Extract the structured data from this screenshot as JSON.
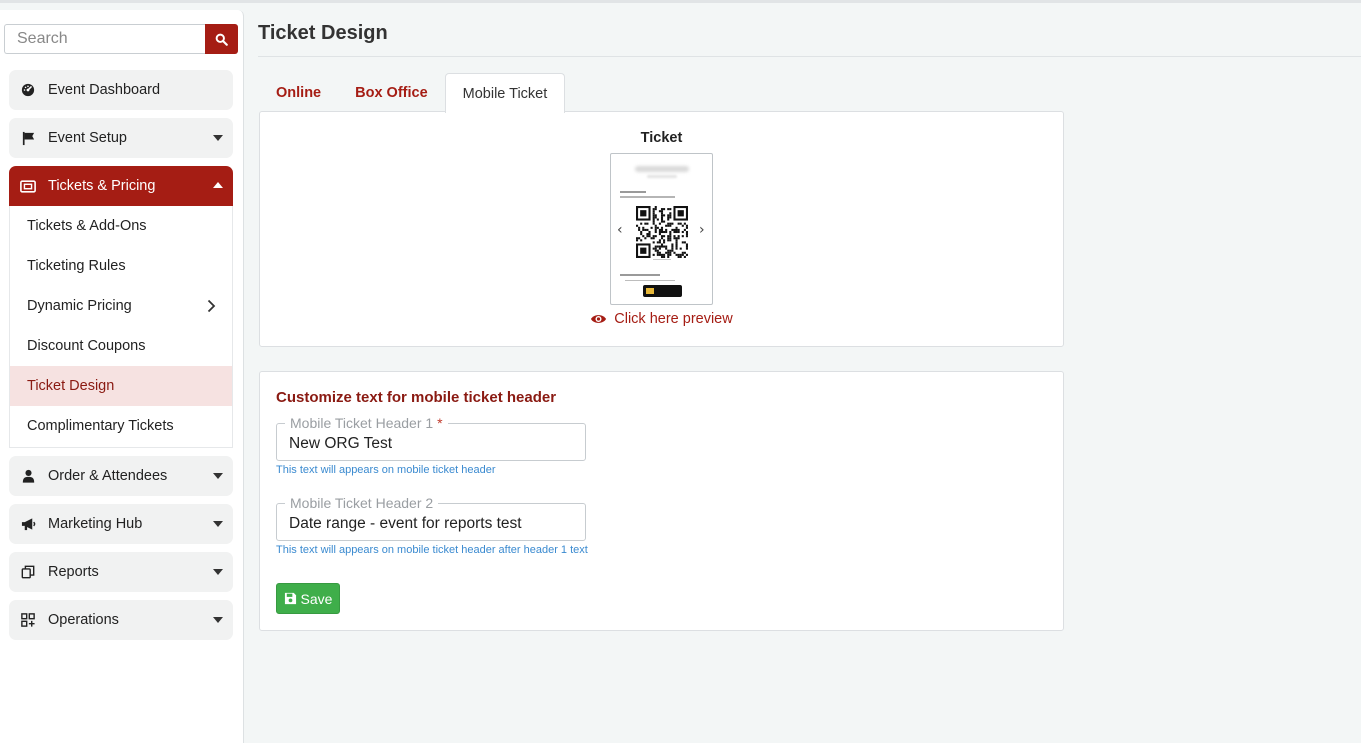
{
  "sidebar": {
    "search": {
      "placeholder": "Search",
      "value": ""
    },
    "items": [
      {
        "label": "Event Dashboard",
        "icon": "dashboard-icon"
      },
      {
        "label": "Event Setup",
        "icon": "flag-icon"
      },
      {
        "label": "Tickets & Pricing",
        "icon": "ticket-icon",
        "expanded": true
      },
      {
        "label": "Order & Attendees",
        "icon": "user-icon"
      },
      {
        "label": "Marketing Hub",
        "icon": "megaphone-icon"
      },
      {
        "label": "Reports",
        "icon": "copy-icon"
      },
      {
        "label": "Operations",
        "icon": "grid-plus-icon"
      }
    ],
    "submenu": [
      {
        "label": "Tickets & Add-Ons"
      },
      {
        "label": "Ticketing Rules"
      },
      {
        "label": "Dynamic Pricing",
        "has_children": true
      },
      {
        "label": "Discount Coupons"
      },
      {
        "label": "Ticket Design",
        "selected": true
      },
      {
        "label": "Complimentary Tickets"
      }
    ]
  },
  "page": {
    "title": "Ticket Design",
    "tabs": [
      {
        "label": "Online"
      },
      {
        "label": "Box Office"
      },
      {
        "label": "Mobile Ticket",
        "active": true
      }
    ]
  },
  "preview": {
    "heading": "Ticket",
    "link_text": "Click here preview"
  },
  "form": {
    "title": "Customize text for mobile ticket header",
    "field1": {
      "label": "Mobile Ticket Header 1",
      "required_mark": "*",
      "value": "New ORG Test",
      "help": "This text will appears on mobile ticket header"
    },
    "field2": {
      "label": "Mobile Ticket Header 2",
      "value": "Date range - event for reports test",
      "help": "This text will appears on mobile ticket header after header 1 text"
    },
    "save_label": "Save"
  },
  "colors": {
    "brand": "#a51d14",
    "save": "#3fae4a",
    "help_text": "#3a8ad0"
  }
}
